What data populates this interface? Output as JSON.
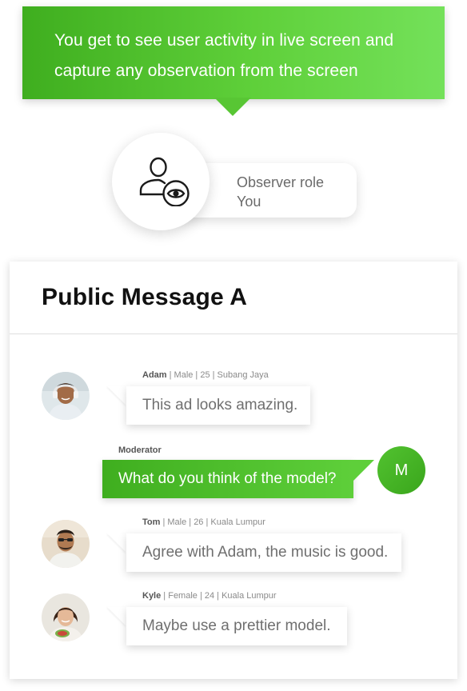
{
  "banner": {
    "line1": "You get to see user activity in live screen and",
    "line2": "capture any observation from the screen"
  },
  "role": {
    "title": "Observer role",
    "name": "You",
    "icon": "observer-user-eye-icon"
  },
  "card": {
    "title": "Public Message A",
    "messages": [
      {
        "name": "Adam",
        "details": " | Male | 25 | Subang Jaya",
        "text": "This ad looks amazing."
      },
      {
        "name": "Tom",
        "details": " | Male | 26 | Kuala Lumpur",
        "text": "Agree with Adam, the music is good."
      },
      {
        "name": "Kyle",
        "details": " | Female | 24 | Kuala Lumpur",
        "text": "Maybe use a prettier model."
      }
    ],
    "moderator": {
      "label": "Moderator",
      "text": "What do you think of the model?",
      "initial": "M"
    }
  },
  "colors": {
    "accent_green": "#4cbf2b",
    "accent_green_light": "#74e15a"
  }
}
